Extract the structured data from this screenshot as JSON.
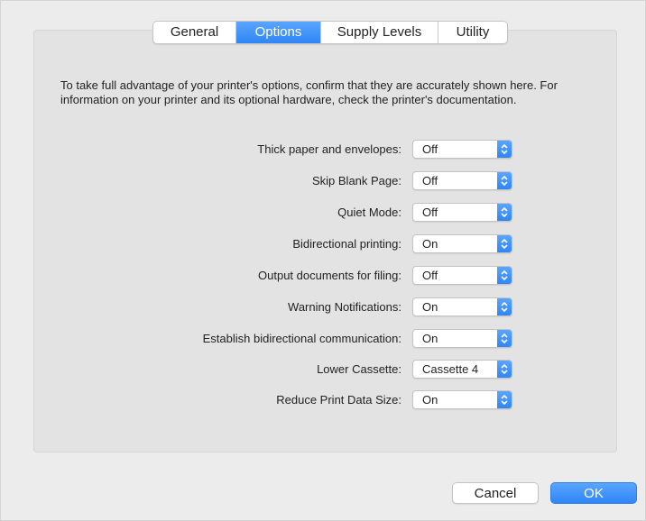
{
  "tabs": [
    {
      "label": "General",
      "active": false
    },
    {
      "label": "Options",
      "active": true
    },
    {
      "label": "Supply Levels",
      "active": false
    },
    {
      "label": "Utility",
      "active": false
    }
  ],
  "description": "To take full advantage of your printer's options, confirm that they are accurately shown here. For information on your printer and its optional hardware, check the printer's documentation.",
  "options": [
    {
      "label": "Thick paper and envelopes:",
      "value": "Off"
    },
    {
      "label": "Skip Blank Page:",
      "value": "Off"
    },
    {
      "label": "Quiet Mode:",
      "value": "Off"
    },
    {
      "label": "Bidirectional printing:",
      "value": "On"
    },
    {
      "label": "Output documents for filing:",
      "value": "Off"
    },
    {
      "label": "Warning Notifications:",
      "value": "On"
    },
    {
      "label": "Establish bidirectional communication:",
      "value": "On"
    },
    {
      "label": "Lower Cassette:",
      "value": "Cassette 4"
    },
    {
      "label": "Reduce Print Data Size:",
      "value": "On"
    }
  ],
  "buttons": {
    "cancel": "Cancel",
    "ok": "OK"
  },
  "colors": {
    "accent": "#2f86f5",
    "panel": "#e3e3e3",
    "window": "#ececec"
  }
}
